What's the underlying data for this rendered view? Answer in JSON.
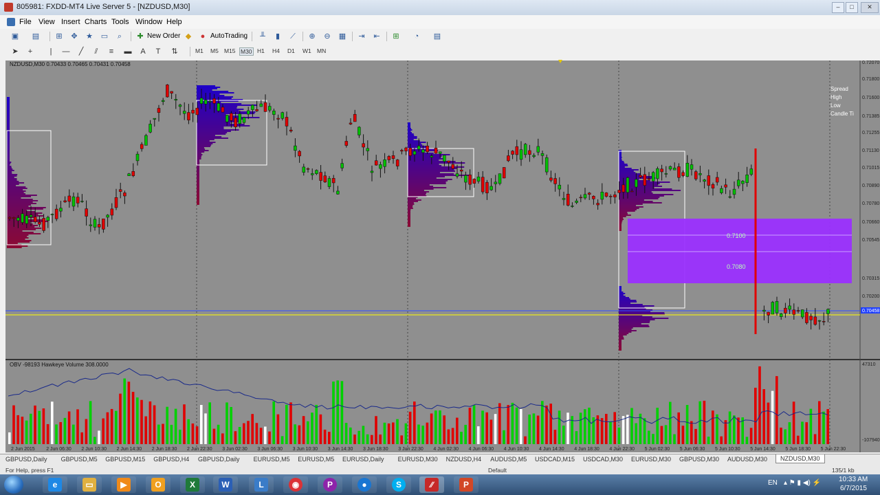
{
  "window": {
    "title": "805981: FXDD-MT4 Live Server 5 - [NZDUSD,M30]"
  },
  "menu": [
    "File",
    "View",
    "Insert",
    "Charts",
    "Tools",
    "Window",
    "Help"
  ],
  "toolbar": {
    "new_order": "New Order",
    "autotrading": "AutoTrading"
  },
  "timeframes": [
    "M1",
    "M5",
    "M15",
    "M30",
    "H1",
    "H4",
    "D1",
    "W1",
    "MN"
  ],
  "chart": {
    "header": "NZDUSD,M30  0.70433 0.70465 0.70431 0.70458",
    "info": [
      "Spread",
      "High",
      "Low",
      "Candle Ti"
    ],
    "price_ticks": [
      "0.72070",
      "0.71800",
      "0.71600",
      "0.71385",
      "0.71255",
      "0.71130",
      "0.71015",
      "0.70890",
      "0.70780",
      "0.70660",
      "0.70545",
      "0.70458",
      "0.70315",
      "0.70200"
    ],
    "current_price": "0.70458",
    "zone_labels": [
      "0.7100",
      "0.7080"
    ],
    "time_labels": [
      "2 Jun 2015",
      "2 Jun 06:30",
      "2 Jun 10:30",
      "2 Jun 14:30",
      "2 Jun 18:30",
      "2 Jun 22:30",
      "3 Jun 02:30",
      "3 Jun 06:30",
      "3 Jun 10:30",
      "3 Jun 14:30",
      "3 Jun 18:30",
      "3 Jun 22:30",
      "4 Jun 02:30",
      "4 Jun 06:30",
      "4 Jun 10:30",
      "4 Jun 14:30",
      "4 Jun 18:30",
      "4 Jun 22:30",
      "5 Jun 02:30",
      "5 Jun 06:30",
      "5 Jun 10:30",
      "5 Jun 14:30",
      "5 Jun 18:30",
      "5 Jun 22:30"
    ]
  },
  "indicator": {
    "header": "OBV -98193  Hawkeye Volume 308.0000",
    "ticks": [
      "47310",
      "-107940"
    ]
  },
  "tabs": [
    "GBPUSD,Daily",
    "GBPUSD,M5",
    "GBPUSD,M15",
    "GBPUSD,H4",
    "GBPUSD,Daily",
    "EURUSD,M5",
    "EURUSD,M5",
    "EURUSD,Daily",
    "EURUSD,M30",
    "NZDUSD,H4",
    "AUDUSD,M5",
    "USDCAD,M15",
    "USDCAD,M30",
    "EURUSD,M30",
    "GBPUSD,M30",
    "AUDUSD,M30",
    "NZDUSD,M30"
  ],
  "active_tab": "NZDUSD,M30",
  "status": {
    "help": "For Help, press F1",
    "profile": "Default",
    "mem": "135/1 kb"
  },
  "tray": {
    "lang": "EN",
    "time": "10:33 AM",
    "date": "6/7/2015"
  },
  "colors": {
    "chart_bg": "#8f8f8f",
    "bull": "#00c000",
    "bear": "#e00000",
    "zone": "#9b30ff",
    "profile_blue": "#1a1ac8",
    "profile_red": "#8b0040"
  }
}
